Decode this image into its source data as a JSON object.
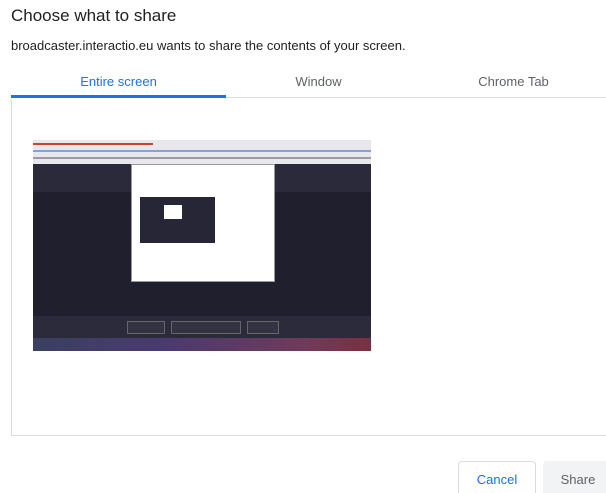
{
  "dialog": {
    "title": "Choose what to share",
    "subtitle": "broadcaster.interactio.eu wants to share the contents of your screen."
  },
  "tabs": [
    {
      "label": "Entire screen",
      "active": true
    },
    {
      "label": "Window",
      "active": false
    },
    {
      "label": "Chrome Tab",
      "active": false
    }
  ],
  "footer": {
    "cancel_label": "Cancel",
    "share_label": "Share"
  },
  "colors": {
    "accent": "#1a73e8",
    "divider": "#dadce0",
    "disabled_bg": "#f1f3f4"
  }
}
